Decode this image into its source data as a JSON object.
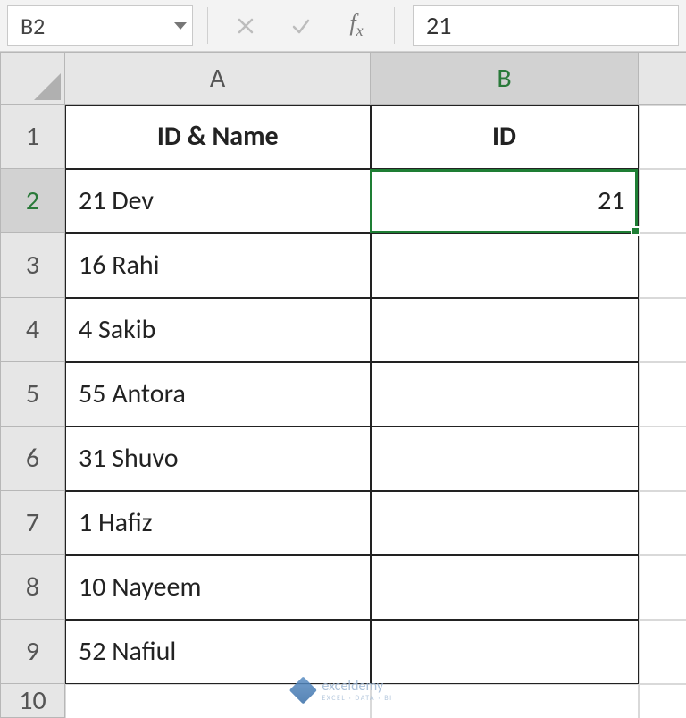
{
  "formula_bar": {
    "name_box": "B2",
    "value": "21"
  },
  "columns": [
    "A",
    "B"
  ],
  "selected_cell": "B2",
  "headers": {
    "A": "ID & Name",
    "B": "ID"
  },
  "rows": [
    {
      "num": "1"
    },
    {
      "num": "2",
      "a": "21 Dev",
      "b": "21"
    },
    {
      "num": "3",
      "a": "16 Rahi",
      "b": ""
    },
    {
      "num": "4",
      "a": "4 Sakib",
      "b": ""
    },
    {
      "num": "5",
      "a": "55 Antora",
      "b": ""
    },
    {
      "num": "6",
      "a": "31 Shuvo",
      "b": ""
    },
    {
      "num": "7",
      "a": "1 Hafiz",
      "b": ""
    },
    {
      "num": "8",
      "a": "10 Nayeem",
      "b": ""
    },
    {
      "num": "9",
      "a": "52 Nafiul",
      "b": ""
    },
    {
      "num": "10"
    }
  ],
  "watermark": {
    "title": "exceldemy",
    "subtitle": "EXCEL · DATA · BI"
  }
}
